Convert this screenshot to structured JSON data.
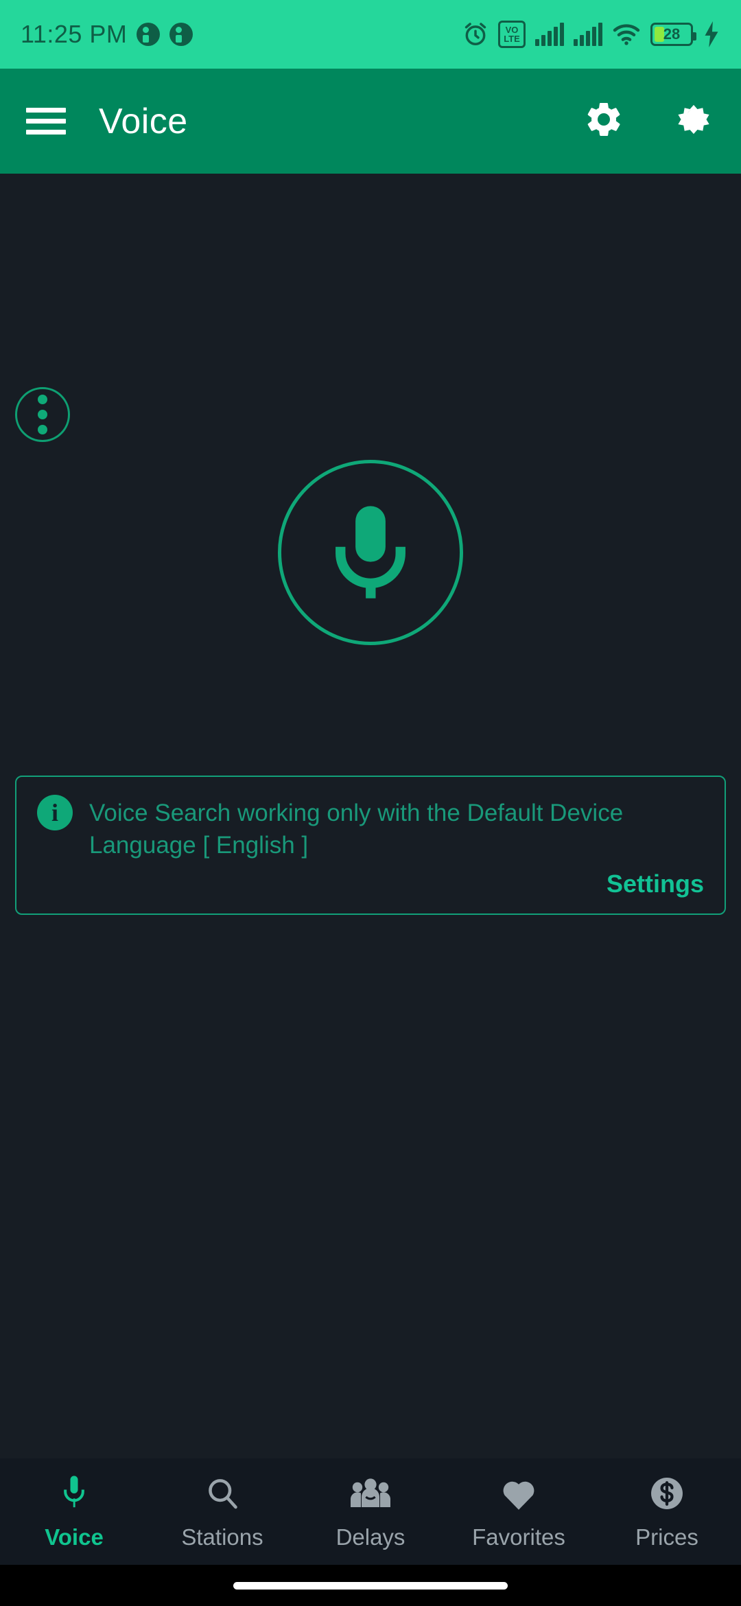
{
  "status_bar": {
    "time": "11:25 PM",
    "notification_icons": [
      "notification-badge-icon",
      "notification-badge-icon"
    ],
    "right_icons": [
      "alarm-icon",
      "volte-icon",
      "signal-icon",
      "signal-icon",
      "wifi-icon",
      "battery-icon",
      "charging-bolt-icon"
    ],
    "volte_top": "VO",
    "volte_bottom": "LTE",
    "battery_level": "28",
    "background_color": "#25d79b",
    "foreground_color": "#0f5e46"
  },
  "app_bar": {
    "menu_icon": "hamburger-menu-icon",
    "title": "Voice",
    "actions": [
      {
        "name": "settings-button",
        "icon": "gear-icon"
      },
      {
        "name": "theme-toggle-button",
        "icon": "brightness-moon-icon"
      }
    ],
    "background_color": "#00875c",
    "title_color": "#ffffff"
  },
  "content": {
    "overflow_menu": {
      "name": "overflow-menu-button",
      "icon": "three-dots-vertical-icon"
    },
    "mic_button": {
      "name": "voice-search-mic-button",
      "icon": "microphone-icon"
    },
    "banner": {
      "icon": "info-icon",
      "icon_glyph": "i",
      "message": "Voice Search working only with the Default Device Language [ English ]",
      "action_label": "Settings",
      "border_color": "#12a079",
      "text_color": "#19997a",
      "action_color": "#12c295"
    },
    "background_color": "#171d24",
    "accent_color": "#0fa878"
  },
  "bottom_nav": {
    "active_index": 0,
    "active_color": "#10c48f",
    "inactive_color": "#9aa4ab",
    "items": [
      {
        "label": "Voice",
        "icon": "microphone-icon"
      },
      {
        "label": "Stations",
        "icon": "search-icon"
      },
      {
        "label": "Delays",
        "icon": "people-group-icon"
      },
      {
        "label": "Favorites",
        "icon": "heart-icon"
      },
      {
        "label": "Prices",
        "icon": "dollar-coin-icon"
      }
    ]
  }
}
